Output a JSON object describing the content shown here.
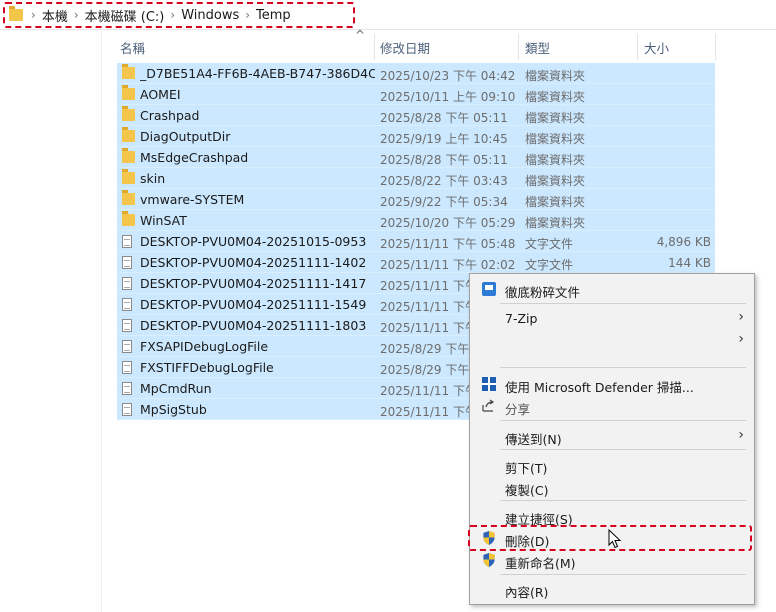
{
  "breadcrumb": {
    "items": [
      "本機",
      "本機磁碟 (C:)",
      "Windows",
      "Temp"
    ],
    "separator": "›"
  },
  "columns": {
    "name": "名稱",
    "date": "修改日期",
    "type": "類型",
    "size": "大小"
  },
  "files": [
    {
      "name": "_D7BE51A4-FF6B-4AEB-B747-386D4C...",
      "date": "2025/10/23 下午 04:42",
      "type": "檔案資料夾",
      "size": "",
      "icon": "folder-icon"
    },
    {
      "name": "AOMEI",
      "date": "2025/10/11 上午 09:10",
      "type": "檔案資料夾",
      "size": "",
      "icon": "folder-icon"
    },
    {
      "name": "Crashpad",
      "date": "2025/8/28 下午 05:11",
      "type": "檔案資料夾",
      "size": "",
      "icon": "folder-icon"
    },
    {
      "name": "DiagOutputDir",
      "date": "2025/9/19 上午 10:45",
      "type": "檔案資料夾",
      "size": "",
      "icon": "folder-icon"
    },
    {
      "name": "MsEdgeCrashpad",
      "date": "2025/8/28 下午 05:11",
      "type": "檔案資料夾",
      "size": "",
      "icon": "folder-icon"
    },
    {
      "name": "skin",
      "date": "2025/8/22 下午 03:43",
      "type": "檔案資料夾",
      "size": "",
      "icon": "folder-icon"
    },
    {
      "name": "vmware-SYSTEM",
      "date": "2025/9/22 下午 05:34",
      "type": "檔案資料夾",
      "size": "",
      "icon": "folder-icon"
    },
    {
      "name": "WinSAT",
      "date": "2025/10/20 下午 05:29",
      "type": "檔案資料夾",
      "size": "",
      "icon": "folder-icon"
    },
    {
      "name": "DESKTOP-PVU0M04-20251015-0953",
      "date": "2025/11/11 下午 05:48",
      "type": "文字文件",
      "size": "4,896 KB",
      "icon": "text-file-icon"
    },
    {
      "name": "DESKTOP-PVU0M04-20251111-1402",
      "date": "2025/11/11 下午 02:02",
      "type": "文字文件",
      "size": "144 KB",
      "icon": "text-file-icon"
    },
    {
      "name": "DESKTOP-PVU0M04-20251111-1417",
      "date": "2025/11/11 下午",
      "type": "",
      "size": "",
      "icon": "text-file-icon"
    },
    {
      "name": "DESKTOP-PVU0M04-20251111-1549",
      "date": "2025/11/11 下午",
      "type": "",
      "size": "",
      "icon": "text-file-icon"
    },
    {
      "name": "DESKTOP-PVU0M04-20251111-1803",
      "date": "2025/11/11 下午",
      "type": "",
      "size": "",
      "icon": "text-file-icon"
    },
    {
      "name": "FXSAPIDebugLogFile",
      "date": "2025/8/29 下午",
      "type": "",
      "size": "",
      "icon": "text-file-icon"
    },
    {
      "name": "FXSTIFFDebugLogFile",
      "date": "2025/8/29 下午",
      "type": "",
      "size": "",
      "icon": "text-file-icon"
    },
    {
      "name": "MpCmdRun",
      "date": "2025/11/11 下午",
      "type": "",
      "size": "",
      "icon": "text-file-icon"
    },
    {
      "name": "MpSigStub",
      "date": "2025/11/11 下午",
      "type": "",
      "size": "",
      "icon": "text-file-icon"
    }
  ],
  "context_menu": {
    "shred": "徹底粉碎文件",
    "sevenzip": "7-Zip",
    "defender": "使用 Microsoft Defender 掃描...",
    "share": "分享",
    "sendto": "傳送到(N)",
    "cut": "剪下(T)",
    "copy": "複製(C)",
    "shortcut": "建立捷徑(S)",
    "delete": "刪除(D)",
    "rename": "重新命名(M)",
    "properties": "內容(R)"
  },
  "colors": {
    "selection": "#cce8ff",
    "highlight_dash": "#d4001e",
    "menu_bg": "#f2f2f2"
  }
}
